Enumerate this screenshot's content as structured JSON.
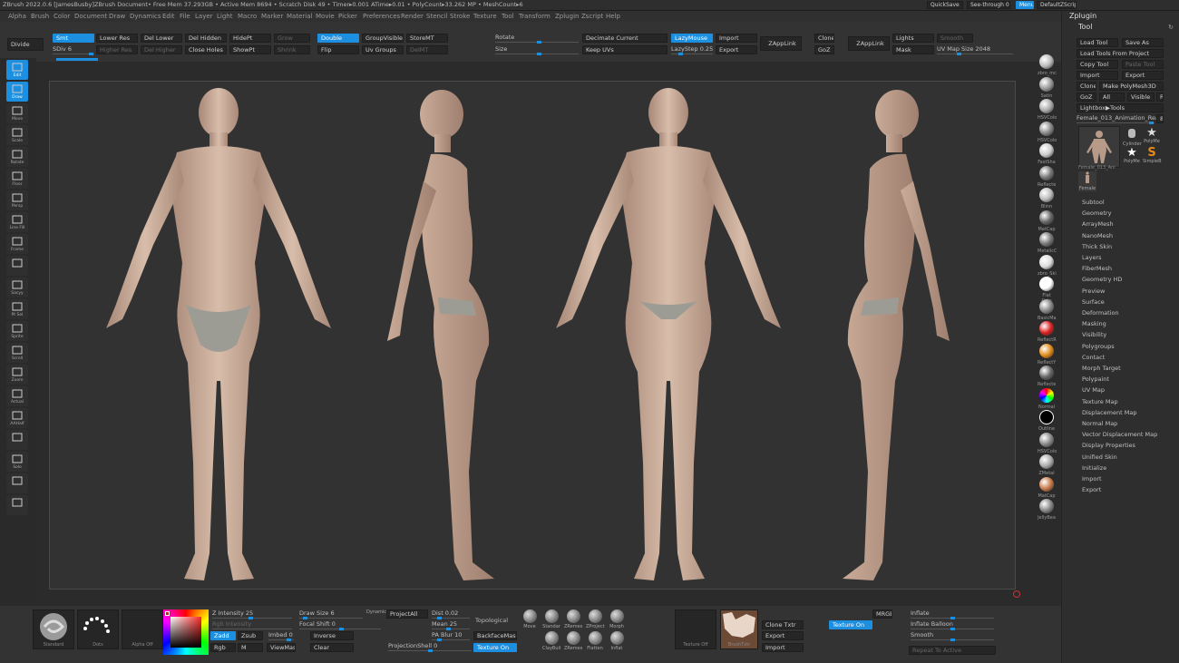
{
  "title_bar": {
    "app": "ZBrush 2022.0.6 [JamesBusby]",
    "doc": "ZBrush Document",
    "free_mem": "• Free Mem 37.293GB • Active Mem 8694 • Scratch Disk 49 • Timer▸0.001 ATime▸0.01 • PolyCount▸33.262 MP • MeshCount▸6",
    "quicksave": "QuickSave",
    "see_through": "See-through 0",
    "menus": "Menus",
    "default_zscript": "DefaultZScript"
  },
  "menu": [
    "Alpha",
    "Brush",
    "Color",
    "Document",
    "Draw",
    "Dynamics",
    "Edit",
    "File",
    "Layer",
    "Light",
    "Macro",
    "Marker",
    "Material",
    "Movie",
    "Picker",
    "Preferences",
    "Render",
    "Stencil",
    "Stroke",
    "Texture",
    "Tool",
    "Transform",
    "Zplugin",
    "Zscript",
    "Help"
  ],
  "top_shelf": {
    "divide": "Divide",
    "smt": "Smt",
    "sdiv": "SDiv 6",
    "lower_res": "Lower Res",
    "higher_res": "Higher Res",
    "del_lower": "Del Lower",
    "del_higher": "Del Higher",
    "del_hidden": "Del Hidden",
    "close_holes": "Close Holes",
    "hide_pt": "HidePt",
    "show_pt": "ShowPt",
    "grow": "Grow",
    "shrink": "Shrink",
    "double": "Double",
    "flip": "Flip",
    "group_visible": "GroupVisible",
    "uv_groups": "Uv Groups",
    "store_mt": "StoreMT",
    "del_mt": "DelMT",
    "rotate": "Rotate",
    "size": "Size",
    "decimate_current": "Decimate Current",
    "keep_uvs": "Keep UVs",
    "lazy_mouse": "LazyMouse",
    "lazy_step": "LazyStep 0.25",
    "import": "Import",
    "export": "Export",
    "zapplink": "ZAppLink",
    "clone": "Clone",
    "goz": "GoZ",
    "zapplink2": "ZAppLink",
    "lights": "Lights",
    "mask": "Mask",
    "smooth": "Smooth",
    "uv_map_size": "UV Map Size 2048"
  },
  "left_tools": [
    "Edit",
    "Draw",
    "Move",
    "Scale",
    "Rotate",
    "Floor",
    "Persp",
    "Line Fill",
    "Frame",
    "",
    "Sacyy",
    "Pt Sel",
    "Sprite",
    "Scroll",
    "Zoom",
    "Actual",
    "AAHalf",
    "",
    "Solo",
    "",
    ""
  ],
  "materials": [
    "zbro_mc",
    "Satin",
    "HSVColo",
    "HSVColo",
    "FastSha",
    "Reflecte",
    "Blinn",
    "MatCap",
    "MetalicC",
    "zbro_Ski",
    "Flat Colo",
    "BasicMa",
    "ReflectR",
    "ReflectY",
    "Reflecte",
    "Normal",
    "Outline",
    "HSVColo",
    "ZMetal",
    "MatCap",
    "JellyBea"
  ],
  "right_panel": {
    "zplugin": "Zplugin",
    "tool": "Tool",
    "load_tool": "Load Tool",
    "save_as": "Save As",
    "load_tools_from_project": "Load Tools From Project",
    "copy_tool": "Copy Tool",
    "paste_tool": "Paste Tool",
    "import": "Import",
    "export": "Export",
    "clone": "Clone",
    "make_polymesh": "Make PolyMesh3D",
    "goz": "GoZ",
    "all": "All",
    "visible": "Visible",
    "r": "R",
    "lightbox_tools": "Lightbox▶Tools",
    "current_tool": "Female_013_Animation_Read",
    "current_tool_n": "8",
    "thumbs": [
      "Female_013_Ani",
      "Cylinder",
      "PolyMe",
      "PolyMe",
      "SimpleB",
      "Female"
    ],
    "items": [
      "Subtool",
      "Geometry",
      "ArrayMesh",
      "NanoMesh",
      "Thick Skin",
      "Layers",
      "FiberMesh",
      "Geometry HD",
      "Preview",
      "Surface",
      "Deformation",
      "Masking",
      "Visibility",
      "Polygroups",
      "Contact",
      "Morph Target",
      "Polypaint",
      "UV Map",
      "Texture Map",
      "Displacement Map",
      "Normal Map",
      "Vector Displacement Map",
      "Display Properties",
      "Unified Skin",
      "Initialize",
      "Import",
      "Export"
    ]
  },
  "bottom_shelf": {
    "standard": "Standard",
    "dots": "Dots",
    "alpha_off": "Alpha Off",
    "z_intensity": "Z Intensity 25",
    "rgb_intensity": "Rgb Intensity",
    "zadd": "Zadd",
    "zsub": "Zsub",
    "imbed": "Imbed 0",
    "rgb": "Rgb",
    "m": "M",
    "viewmask": "ViewMask",
    "draw_size": "Draw Size 6",
    "dynamic": "Dynamic",
    "focal_shift": "Focal Shift 0",
    "inverse": "Inverse",
    "clear": "Clear",
    "project_all": "ProjectAll",
    "dist": "Dist 0.02",
    "mean": "Mean 25",
    "pa_blur": "PA Blur 10",
    "projection_shell": "ProjectionShell 0",
    "topological": "Topological",
    "backface_mask": "BackfaceMask",
    "texture_on": "Texture On",
    "brushes": [
      "Move",
      "Standar",
      "ZRemes",
      "ZProject",
      "Morph",
      "ClayBuil",
      "ZRemes",
      "Flatten",
      "Inflat"
    ],
    "texture_off": "Texture Off",
    "brush_txtr": "BrushTxtr",
    "clone_txtr": "Clone Txtr",
    "export": "Export",
    "import": "Import",
    "texture_on2": "Texture On",
    "mrgb": "MRGB",
    "inflate": "Inflate",
    "inflate_balloon": "Inflate Balloon",
    "smooth": "Smooth",
    "repeat_to_active": "Repeat To Active"
  },
  "colors": {
    "accent": "#1c8fe0",
    "canvas": "#323232",
    "panel": "#333333"
  },
  "figure_views": [
    "front",
    "side-left",
    "back",
    "side-right"
  ]
}
